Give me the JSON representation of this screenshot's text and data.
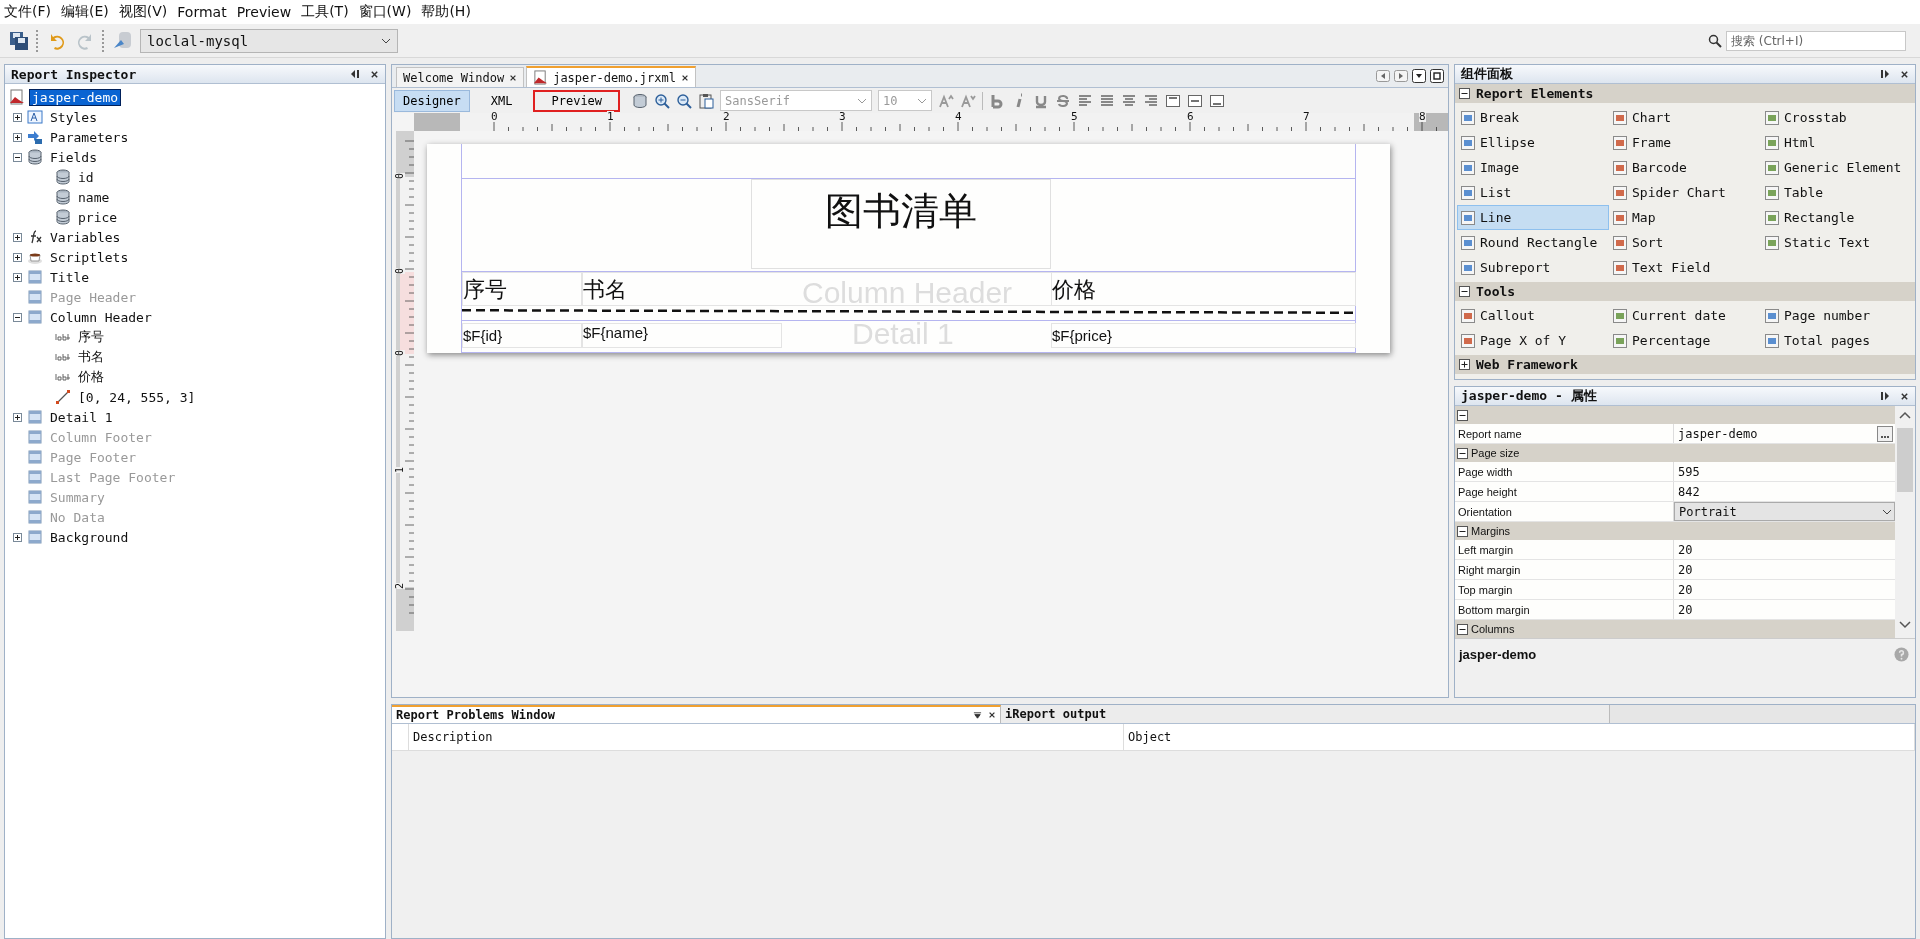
{
  "menu": [
    "文件(F)",
    "编辑(E)",
    "视图(V)",
    "Format",
    "Preview",
    "工具(T)",
    "窗口(W)",
    "帮助(H)"
  ],
  "toolbar": {
    "datasource": "loclal-mysql"
  },
  "search": {
    "placeholder": "搜索 (Ctrl+I)"
  },
  "inspector": {
    "title": "Report Inspector",
    "tree": [
      {
        "label": "jasper-demo",
        "kind": "report",
        "selected": true,
        "disabled": false,
        "children": [
          {
            "label": "Styles",
            "kind": "styles",
            "selected": false,
            "disabled": false,
            "expanded": false
          },
          {
            "label": "Parameters",
            "kind": "parameters",
            "selected": false,
            "disabled": false,
            "expanded": false
          },
          {
            "label": "Fields",
            "kind": "fields",
            "selected": false,
            "disabled": false,
            "expanded": true,
            "children": [
              {
                "label": "id",
                "kind": "field",
                "selected": false,
                "disabled": false
              },
              {
                "label": "name",
                "kind": "field",
                "selected": false,
                "disabled": false
              },
              {
                "label": "price",
                "kind": "field",
                "selected": false,
                "disabled": false
              }
            ]
          },
          {
            "label": "Variables",
            "kind": "variables",
            "selected": false,
            "disabled": false,
            "expanded": false
          },
          {
            "label": "Scriptlets",
            "kind": "scriptlets",
            "selected": false,
            "disabled": false,
            "expanded": false
          },
          {
            "label": "Title",
            "kind": "band",
            "selected": false,
            "disabled": false,
            "expanded": false
          },
          {
            "label": "Page Header",
            "kind": "band",
            "selected": false,
            "disabled": true
          },
          {
            "label": "Column Header",
            "kind": "band",
            "selected": false,
            "disabled": false,
            "expanded": true,
            "children": [
              {
                "label": "序号",
                "kind": "label",
                "selected": false,
                "disabled": false
              },
              {
                "label": "书名",
                "kind": "label",
                "selected": false,
                "disabled": false
              },
              {
                "label": "价格",
                "kind": "label",
                "selected": false,
                "disabled": false
              },
              {
                "label": "[0, 24, 555, 3]",
                "kind": "line",
                "selected": false,
                "disabled": false
              }
            ]
          },
          {
            "label": "Detail 1",
            "kind": "band",
            "selected": false,
            "disabled": false,
            "expanded": false
          },
          {
            "label": "Column Footer",
            "kind": "band",
            "selected": false,
            "disabled": true
          },
          {
            "label": "Page Footer",
            "kind": "band",
            "selected": false,
            "disabled": true
          },
          {
            "label": "Last Page Footer",
            "kind": "band",
            "selected": false,
            "disabled": true
          },
          {
            "label": "Summary",
            "kind": "band",
            "selected": false,
            "disabled": true
          },
          {
            "label": "No Data",
            "kind": "band",
            "selected": false,
            "disabled": true
          },
          {
            "label": "Background",
            "kind": "band",
            "selected": false,
            "disabled": false,
            "expanded": false
          }
        ]
      }
    ]
  },
  "editor": {
    "tabs": [
      {
        "label": "Welcome Window",
        "selected": false
      },
      {
        "label": "jasper-demo.jrxml",
        "selected": true
      }
    ],
    "modes": [
      {
        "label": "Designer",
        "selected": true,
        "highlighted": false
      },
      {
        "label": "XML",
        "selected": false,
        "highlighted": false
      },
      {
        "label": "Preview",
        "selected": false,
        "highlighted": true
      }
    ],
    "font": "SansSerif",
    "size": "10",
    "ruler_h": [
      "0",
      "1",
      "2",
      "3",
      "4",
      "5",
      "6",
      "7",
      "8"
    ],
    "ruler_v": [
      "0",
      "0",
      "0",
      "1",
      "2"
    ],
    "report": {
      "title": "图书清单",
      "headers": [
        "序号",
        "书名",
        "价格"
      ],
      "fields": [
        "$F{id}",
        "$F{name}",
        "$F{price}"
      ],
      "band_labels": [
        "Column Header",
        "Detail 1"
      ]
    }
  },
  "palette": {
    "title": "组件面板",
    "groups": [
      {
        "label": "Report Elements",
        "expanded": true,
        "items": [
          {
            "label": "Break",
            "selected": false
          },
          {
            "label": "Chart",
            "selected": false
          },
          {
            "label": "Crosstab",
            "selected": false
          },
          {
            "label": "Ellipse",
            "selected": false
          },
          {
            "label": "Frame",
            "selected": false
          },
          {
            "label": "Html",
            "selected": false
          },
          {
            "label": "Image",
            "selected": false
          },
          {
            "label": "Barcode",
            "selected": false
          },
          {
            "label": "Generic Element",
            "selected": false
          },
          {
            "label": "List",
            "selected": false
          },
          {
            "label": "Spider Chart",
            "selected": false
          },
          {
            "label": "Table",
            "selected": false
          },
          {
            "label": "Line",
            "selected": true
          },
          {
            "label": "Map",
            "selected": false
          },
          {
            "label": "Rectangle",
            "selected": false
          },
          {
            "label": "Round Rectangle",
            "selected": false
          },
          {
            "label": "Sort",
            "selected": false
          },
          {
            "label": "Static Text",
            "selected": false
          },
          {
            "label": "Subreport",
            "selected": false
          },
          {
            "label": "Text Field",
            "selected": false
          }
        ]
      },
      {
        "label": "Tools",
        "expanded": true,
        "items": [
          {
            "label": "Callout",
            "selected": false
          },
          {
            "label": "Current date",
            "selected": false
          },
          {
            "label": "Page number",
            "selected": false
          },
          {
            "label": "Page X of Y",
            "selected": false
          },
          {
            "label": "Percentage",
            "selected": false
          },
          {
            "label": "Total pages",
            "selected": false
          }
        ]
      },
      {
        "label": "Web Framework",
        "expanded": false
      }
    ]
  },
  "properties": {
    "title": "jasper-demo - 属性",
    "sections": [
      {
        "expanded": true,
        "rows": [
          {
            "name": "Report name",
            "value": "jasper-demo",
            "kind": "text-more"
          }
        ]
      },
      {
        "label": "Page size",
        "expanded": true,
        "rows": [
          {
            "name": "Page width",
            "value": "595",
            "kind": "text"
          },
          {
            "name": "Page height",
            "value": "842",
            "kind": "text"
          },
          {
            "name": "Orientation",
            "value": "Portrait",
            "kind": "dropdown"
          }
        ]
      },
      {
        "label": "Margins",
        "expanded": true,
        "rows": [
          {
            "name": "Left margin",
            "value": "20",
            "kind": "text"
          },
          {
            "name": "Right margin",
            "value": "20",
            "kind": "text"
          },
          {
            "name": "Top margin",
            "value": "20",
            "kind": "text"
          },
          {
            "name": "Bottom margin",
            "value": "20",
            "kind": "text"
          }
        ]
      },
      {
        "label": "Columns",
        "expanded": true
      }
    ],
    "footer": "jasper-demo"
  },
  "bottom": {
    "tabs": [
      {
        "label": "Report Problems Window",
        "selected": true
      },
      {
        "label": "iReport output",
        "selected": false
      }
    ],
    "columns": [
      "Description",
      "Object"
    ]
  }
}
